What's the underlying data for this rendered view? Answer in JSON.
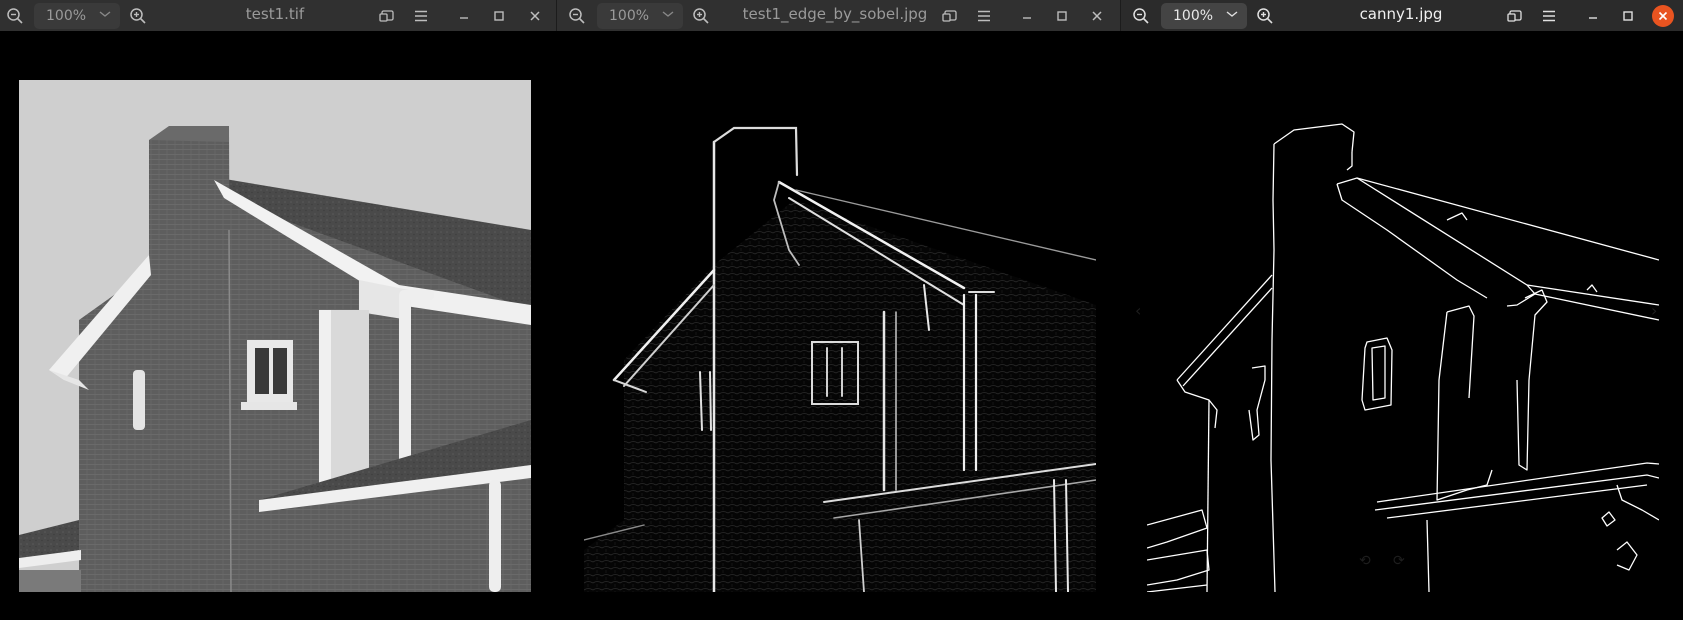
{
  "windows": [
    {
      "title": "test1.tif",
      "zoom": "100%",
      "active": false,
      "image": "grayscale photograph of a brick house with chimney and roof gutters"
    },
    {
      "title": "test1_edge_by_sobel.jpg",
      "zoom": "100%",
      "active": false,
      "image": "Sobel edge detection result of the house photo"
    },
    {
      "title": "canny1.jpg",
      "zoom": "100%",
      "active": true,
      "image": "Canny edge detection result of the house photo"
    }
  ],
  "icons": {
    "zoom_out": "zoom-out-icon",
    "zoom_in": "zoom-in-icon",
    "fit": "fit-window-icon",
    "menu": "hamburger-menu-icon",
    "minimize": "minimize-icon",
    "maximize": "maximize-icon",
    "close": "close-icon",
    "rotate_left": "rotate-left-icon",
    "rotate_right": "rotate-right-icon",
    "prev": "previous-image-icon",
    "next": "next-image-icon"
  },
  "colors": {
    "titlebar": "#303030",
    "close_active": "#e95420",
    "canvas": "#000000"
  }
}
